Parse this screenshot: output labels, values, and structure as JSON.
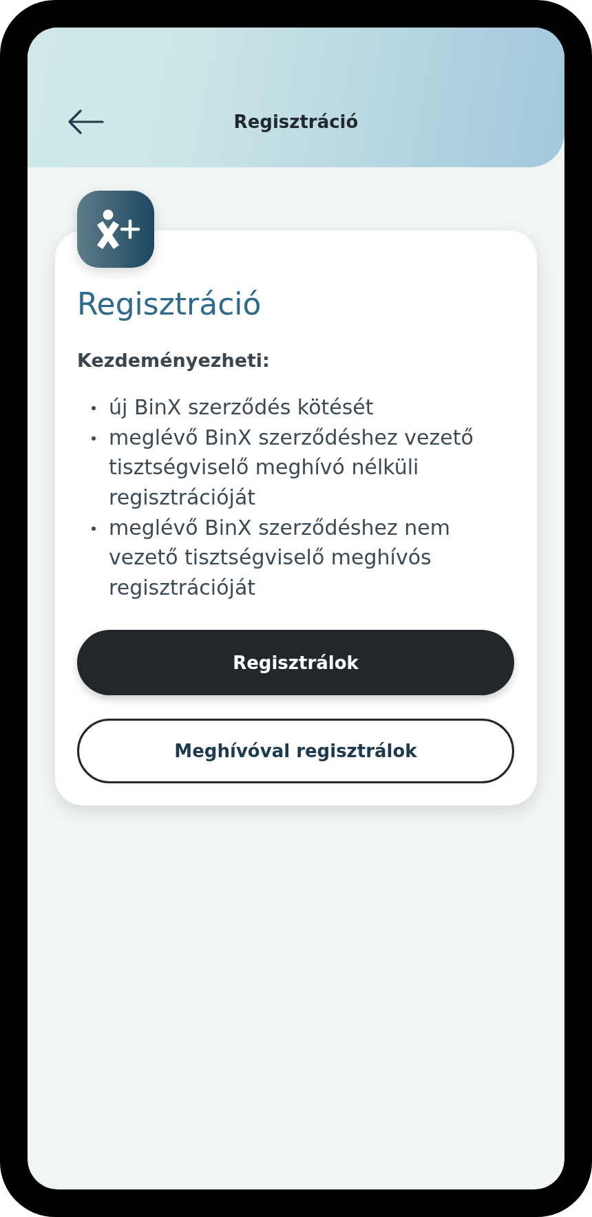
{
  "header": {
    "title": "Regisztráció"
  },
  "card": {
    "title": "Regisztráció",
    "heading": "Kezdeményezheti:",
    "items": [
      "új BinX szerződés kötését",
      "meglévő BinX szerződéshez vezető tisztségviselő meghívó nélküli regisztrációját",
      "meglévő BinX szerződéshez nem vezető tisztségviselő meghívós regisztrációját"
    ],
    "buttons": [
      {
        "label": "Regisztrálok",
        "kind": "primary"
      },
      {
        "label": "Meghívóval regisztrálok",
        "kind": "secondary"
      }
    ]
  }
}
